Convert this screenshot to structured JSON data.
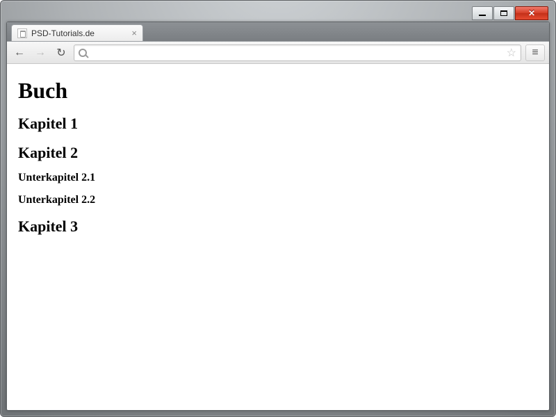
{
  "window": {
    "title": "PSD-Tutorials.de"
  },
  "tabs": [
    {
      "label": "PSD-Tutorials.de"
    }
  ],
  "toolbar": {
    "address": "",
    "placeholder": ""
  },
  "page": {
    "h1": "Buch",
    "sections": {
      "k1": "Kapitel 1",
      "k2": "Kapitel 2",
      "k2_1": "Unterkapitel 2.1",
      "k2_2": "Unterkapitel 2.2",
      "k3": "Kapitel 3"
    }
  }
}
